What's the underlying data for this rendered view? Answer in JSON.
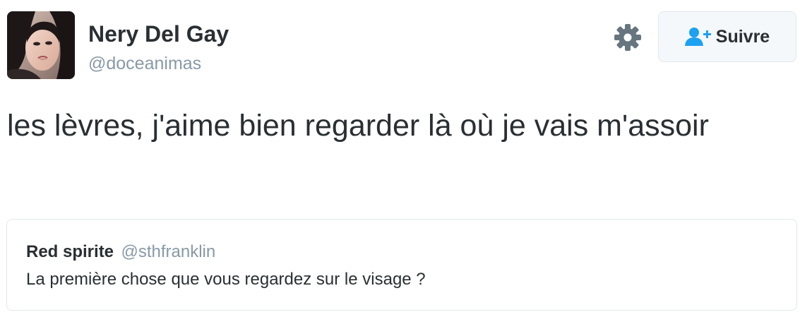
{
  "author": {
    "display_name": "Nery Del Gay",
    "screen_name": "@doceanimas",
    "avatar_icon": "profile-photo"
  },
  "actions": {
    "settings_icon": "gear-icon",
    "follow_icon": "add-user-icon",
    "follow_label": "Suivre"
  },
  "tweet": {
    "text": "les lèvres, j'aime bien regarder là où je vais m'assoir"
  },
  "quoted_tweet": {
    "display_name": "Red spirite",
    "screen_name": "@sthfranklin",
    "text": "La première chose que vous regardez sur le visage ?"
  },
  "colors": {
    "text": "#292f33",
    "secondary_text": "#8899a6",
    "accent": "#1da1f2",
    "border": "#e1e8ed",
    "button_bg": "#f5f8fa",
    "gear": "#66757f"
  }
}
